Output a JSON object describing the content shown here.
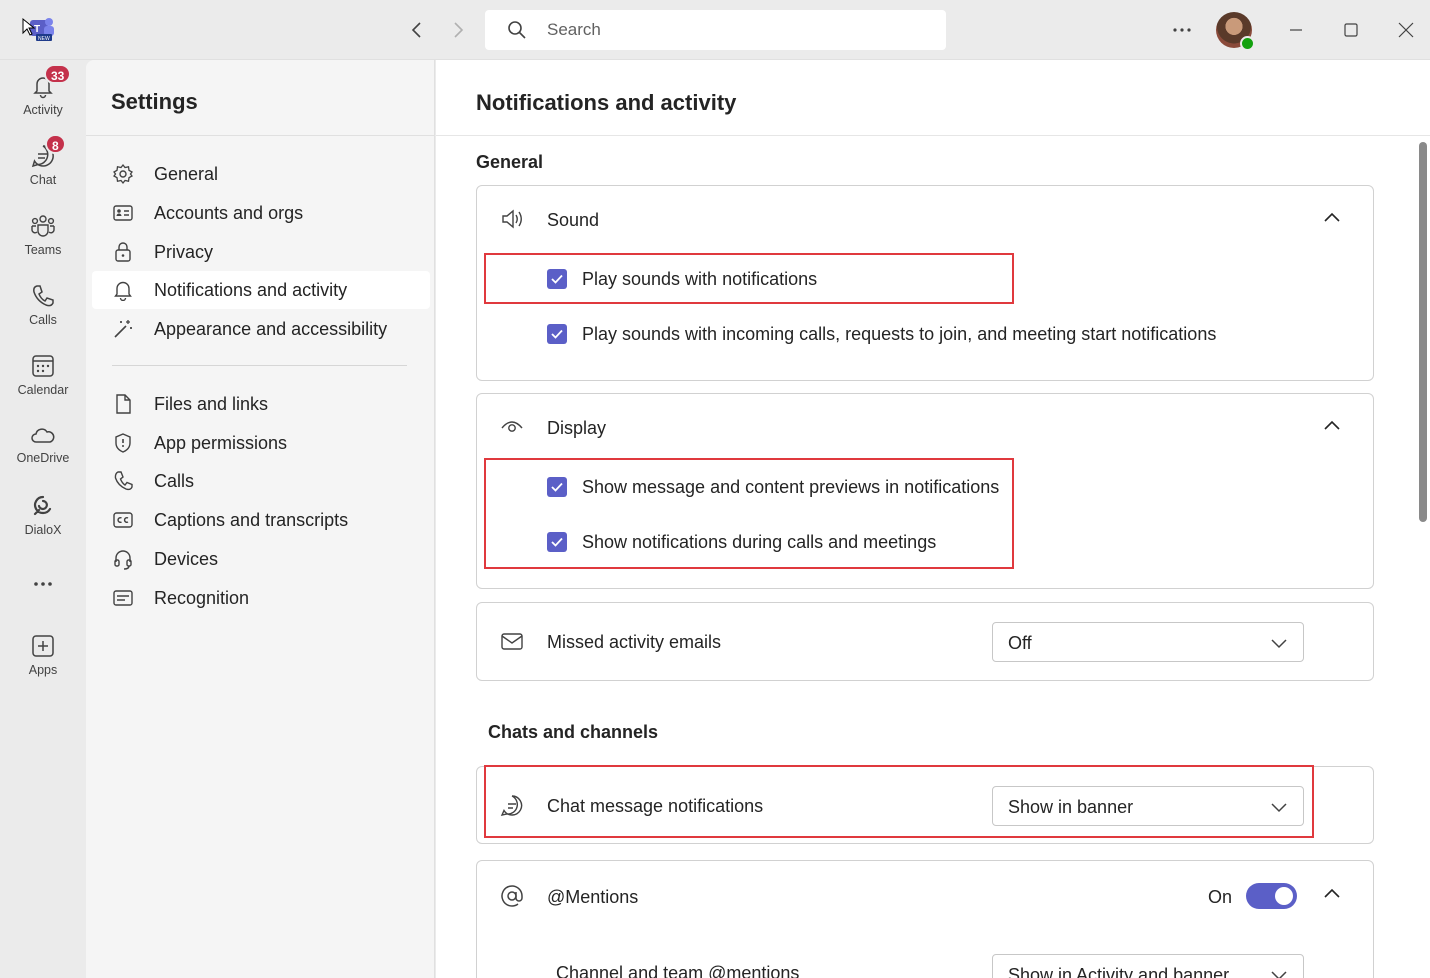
{
  "titlebar": {
    "search_placeholder": "Search"
  },
  "rail": [
    {
      "label": "Activity",
      "badge": "33",
      "icon": "bell-icon"
    },
    {
      "label": "Chat",
      "badge": "8",
      "icon": "chat-icon"
    },
    {
      "label": "Teams",
      "icon": "teams-icon"
    },
    {
      "label": "Calls",
      "icon": "phone-icon"
    },
    {
      "label": "Calendar",
      "icon": "calendar-icon"
    },
    {
      "label": "OneDrive",
      "icon": "cloud-icon"
    },
    {
      "label": "DialoX",
      "icon": "dialox-icon"
    },
    {
      "label": "Apps",
      "icon": "add-app-icon"
    }
  ],
  "settings": {
    "title": "Settings",
    "items": [
      {
        "label": "General",
        "icon": "gear-icon"
      },
      {
        "label": "Accounts and orgs",
        "icon": "id-card-icon"
      },
      {
        "label": "Privacy",
        "icon": "lock-icon"
      },
      {
        "label": "Notifications and activity",
        "icon": "bell-icon",
        "selected": true
      },
      {
        "label": "Appearance and accessibility",
        "icon": "magic-wand-icon"
      },
      {
        "label": "Files and links",
        "icon": "document-icon"
      },
      {
        "label": "App permissions",
        "icon": "shield-icon"
      },
      {
        "label": "Calls",
        "icon": "phone-icon"
      },
      {
        "label": "Captions and transcripts",
        "icon": "closed-caption-icon"
      },
      {
        "label": "Devices",
        "icon": "headset-icon"
      },
      {
        "label": "Recognition",
        "icon": "recognition-icon"
      }
    ]
  },
  "main": {
    "title": "Notifications and activity",
    "general_heading": "General",
    "sound": {
      "title": "Sound",
      "options": [
        {
          "label": "Play sounds with notifications",
          "checked": true
        },
        {
          "label": "Play sounds with incoming calls, requests to join, and meeting start notifications",
          "checked": true
        }
      ]
    },
    "display": {
      "title": "Display",
      "options": [
        {
          "label": "Show message and content previews in notifications",
          "checked": true
        },
        {
          "label": "Show notifications during calls and meetings",
          "checked": true
        }
      ]
    },
    "missed": {
      "title": "Missed activity emails",
      "value": "Off"
    },
    "chats_heading": "Chats and channels",
    "chat_notif": {
      "title": "Chat message notifications",
      "value": "Show in banner"
    },
    "mentions": {
      "title": "@Mentions",
      "toggle_label": "On",
      "toggle_on": true,
      "sub_label": "Channel and team @mentions",
      "sub_value": "Show in Activity and banner"
    }
  },
  "colors": {
    "accent": "#5b5fc7",
    "badge": "#c4314b",
    "highlight": "#e0393e",
    "presence": "#13a10e"
  }
}
